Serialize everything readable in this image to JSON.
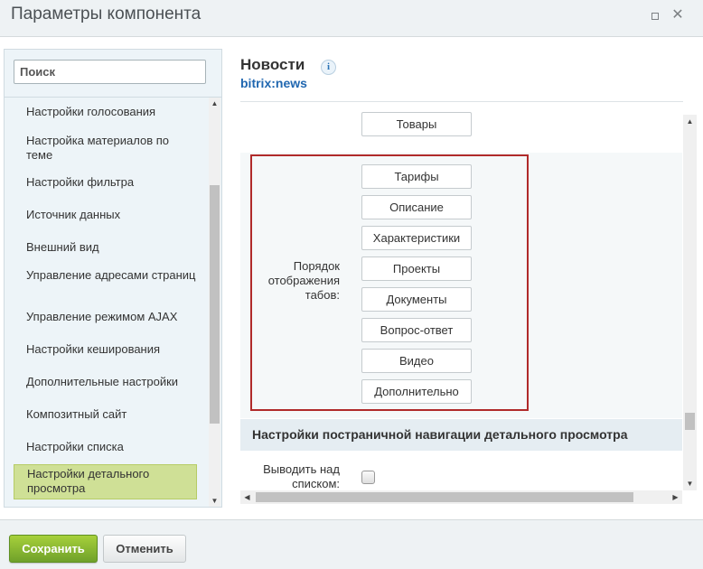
{
  "window": {
    "title": "Параметры компонента"
  },
  "sidebar": {
    "search_placeholder": "Поиск",
    "items": [
      {
        "label": "Настройки голосования"
      },
      {
        "label": "Настройка материалов по теме"
      },
      {
        "label": "Настройки фильтра"
      },
      {
        "label": "Источник данных"
      },
      {
        "label": "Внешний вид"
      },
      {
        "label": "Управление адресами страниц"
      },
      {
        "label": "Управление режимом AJAX"
      },
      {
        "label": "Настройки кеширования"
      },
      {
        "label": "Дополнительные настройки"
      },
      {
        "label": "Композитный сайт"
      },
      {
        "label": "Настройки списка"
      },
      {
        "label": "Настройки детального просмотра",
        "active": true
      }
    ]
  },
  "component": {
    "name": "Новости",
    "code": "bitrix:news",
    "info_icon": "i"
  },
  "main": {
    "top_tab": "Товары",
    "tab_order_label": "Порядок отображения табов:",
    "tabs": [
      "Тарифы",
      "Описание",
      "Характеристики",
      "Проекты",
      "Документы",
      "Вопрос-ответ",
      "Видео",
      "Дополнительно"
    ],
    "section_title": "Настройки постраничной навигации детального просмотра",
    "show_above_label": "Выводить над списком:",
    "show_above_checked": false
  },
  "footer": {
    "save_label": "Сохранить",
    "cancel_label": "Отменить"
  },
  "colors": {
    "save_button": "#7eb22f",
    "active_sidebar_item": "#cfe096",
    "highlight_frame": "#b02a2a",
    "link": "#2067b0"
  }
}
